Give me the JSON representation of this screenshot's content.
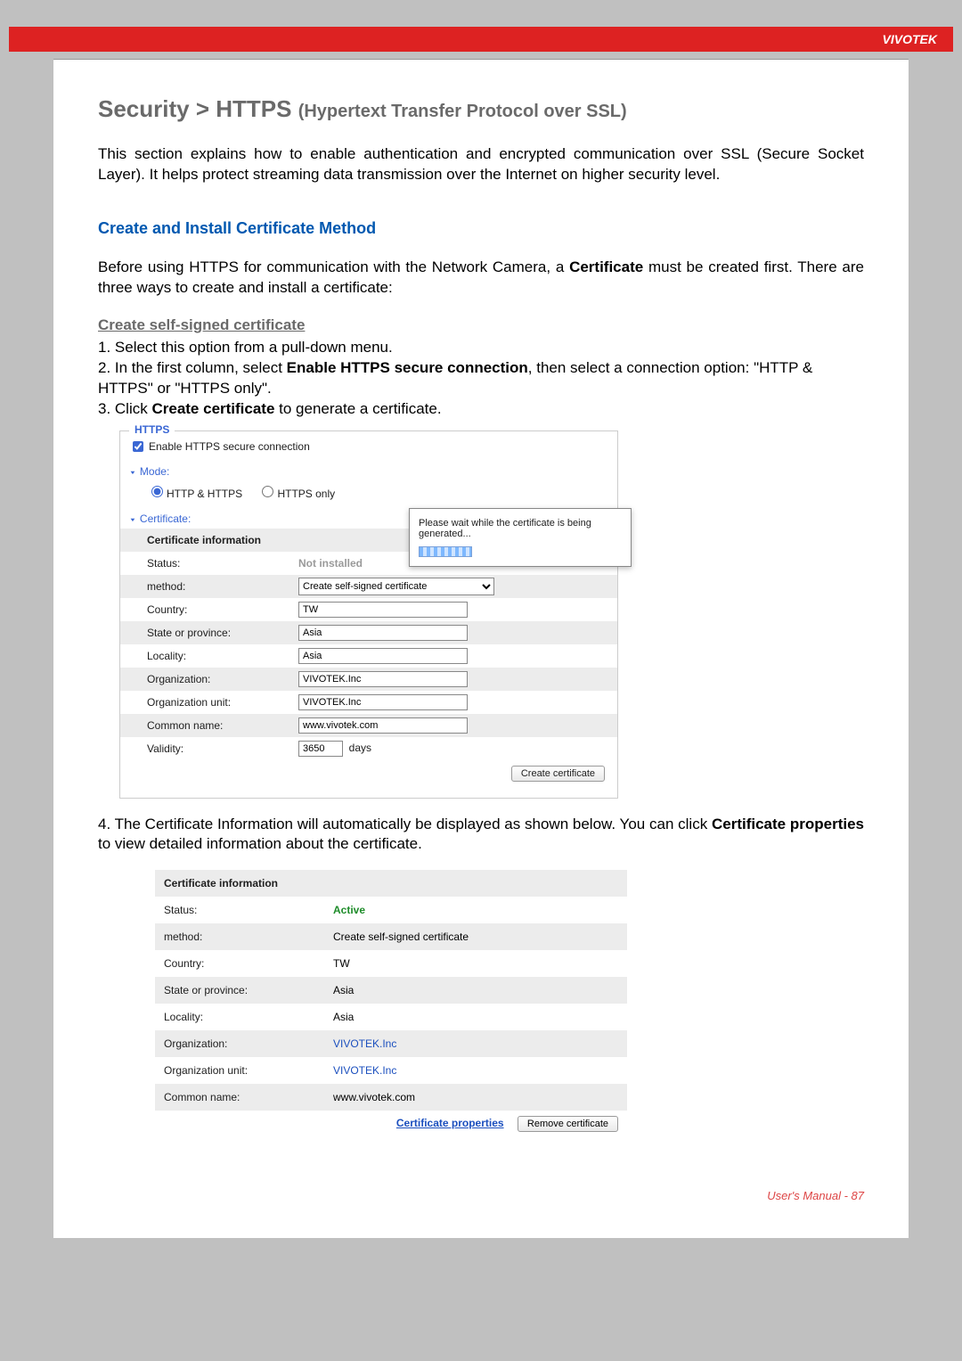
{
  "brand": "VIVOTEK",
  "title_main": "Security >  HTTPS ",
  "title_sub": "(Hypertext Transfer Protocol over SSL)",
  "intro": "This section explains how to enable authentication and encrypted communication over SSL (Secure Socket Layer). It helps protect streaming data transmission over the Internet on higher security level.",
  "section_heading": "Create and Install Certificate Method",
  "before_text_a": "Before using HTTPS for communication with the Network Camera, a ",
  "before_bold": "Certificate",
  "before_text_b": " must be created first. There are three ways to create and install a certificate:",
  "subhead": "Create self-signed certificate",
  "step1": "1. Select this option from a pull-down menu.",
  "step2_a": "2. In the first column, select ",
  "step2_bold": "Enable HTTPS secure connection",
  "step2_b": ", then select a connection option: \"HTTP & HTTPS\" or \"HTTPS only\".",
  "step3_a": "3. Click ",
  "step3_bold": "Create certificate",
  "step3_b": " to generate a certificate.",
  "step4_a": "4. The Certificate Information will automatically be displayed as shown below. You can click ",
  "step4_bold": "Certificate properties",
  "step4_b": " to view detailed information about the certificate.",
  "shot1": {
    "legend": "HTTPS",
    "enable_label": "Enable HTTPS secure connection",
    "mode_label": "Mode:",
    "mode_opt1": "HTTP & HTTPS",
    "mode_opt2": "HTTPS only",
    "cert_label": "Certificate:",
    "info_header": "Certificate information",
    "rows": {
      "status_l": "Status:",
      "status_v": "Not installed",
      "method_l": "method:",
      "method_v": "Create self-signed certificate",
      "country_l": "Country:",
      "country_v": "TW",
      "state_l": "State or province:",
      "state_v": "Asia",
      "locality_l": "Locality:",
      "locality_v": "Asia",
      "org_l": "Organization:",
      "org_v": "VIVOTEK.Inc",
      "unit_l": "Organization unit:",
      "unit_v": "VIVOTEK.Inc",
      "cn_l": "Common name:",
      "cn_v": "www.vivotek.com",
      "validity_l": "Validity:",
      "validity_v": "3650",
      "validity_unit": "days"
    },
    "create_btn": "Create certificate",
    "overlay_text": "Please wait while the certificate is being generated..."
  },
  "shot2": {
    "info_header": "Certificate information",
    "rows": {
      "status_l": "Status:",
      "status_v": "Active",
      "method_l": "method:",
      "method_v": "Create self-signed certificate",
      "country_l": "Country:",
      "country_v": "TW",
      "state_l": "State or province:",
      "state_v": "Asia",
      "locality_l": "Locality:",
      "locality_v": "Asia",
      "org_l": "Organization:",
      "org_v": "VIVOTEK.Inc",
      "unit_l": "Organization unit:",
      "unit_v": "VIVOTEK.Inc",
      "cn_l": "Common name:",
      "cn_v": "www.vivotek.com"
    },
    "props_link": "Certificate properties",
    "remove_btn": "Remove certificate"
  },
  "footer": "User's Manual - 87"
}
